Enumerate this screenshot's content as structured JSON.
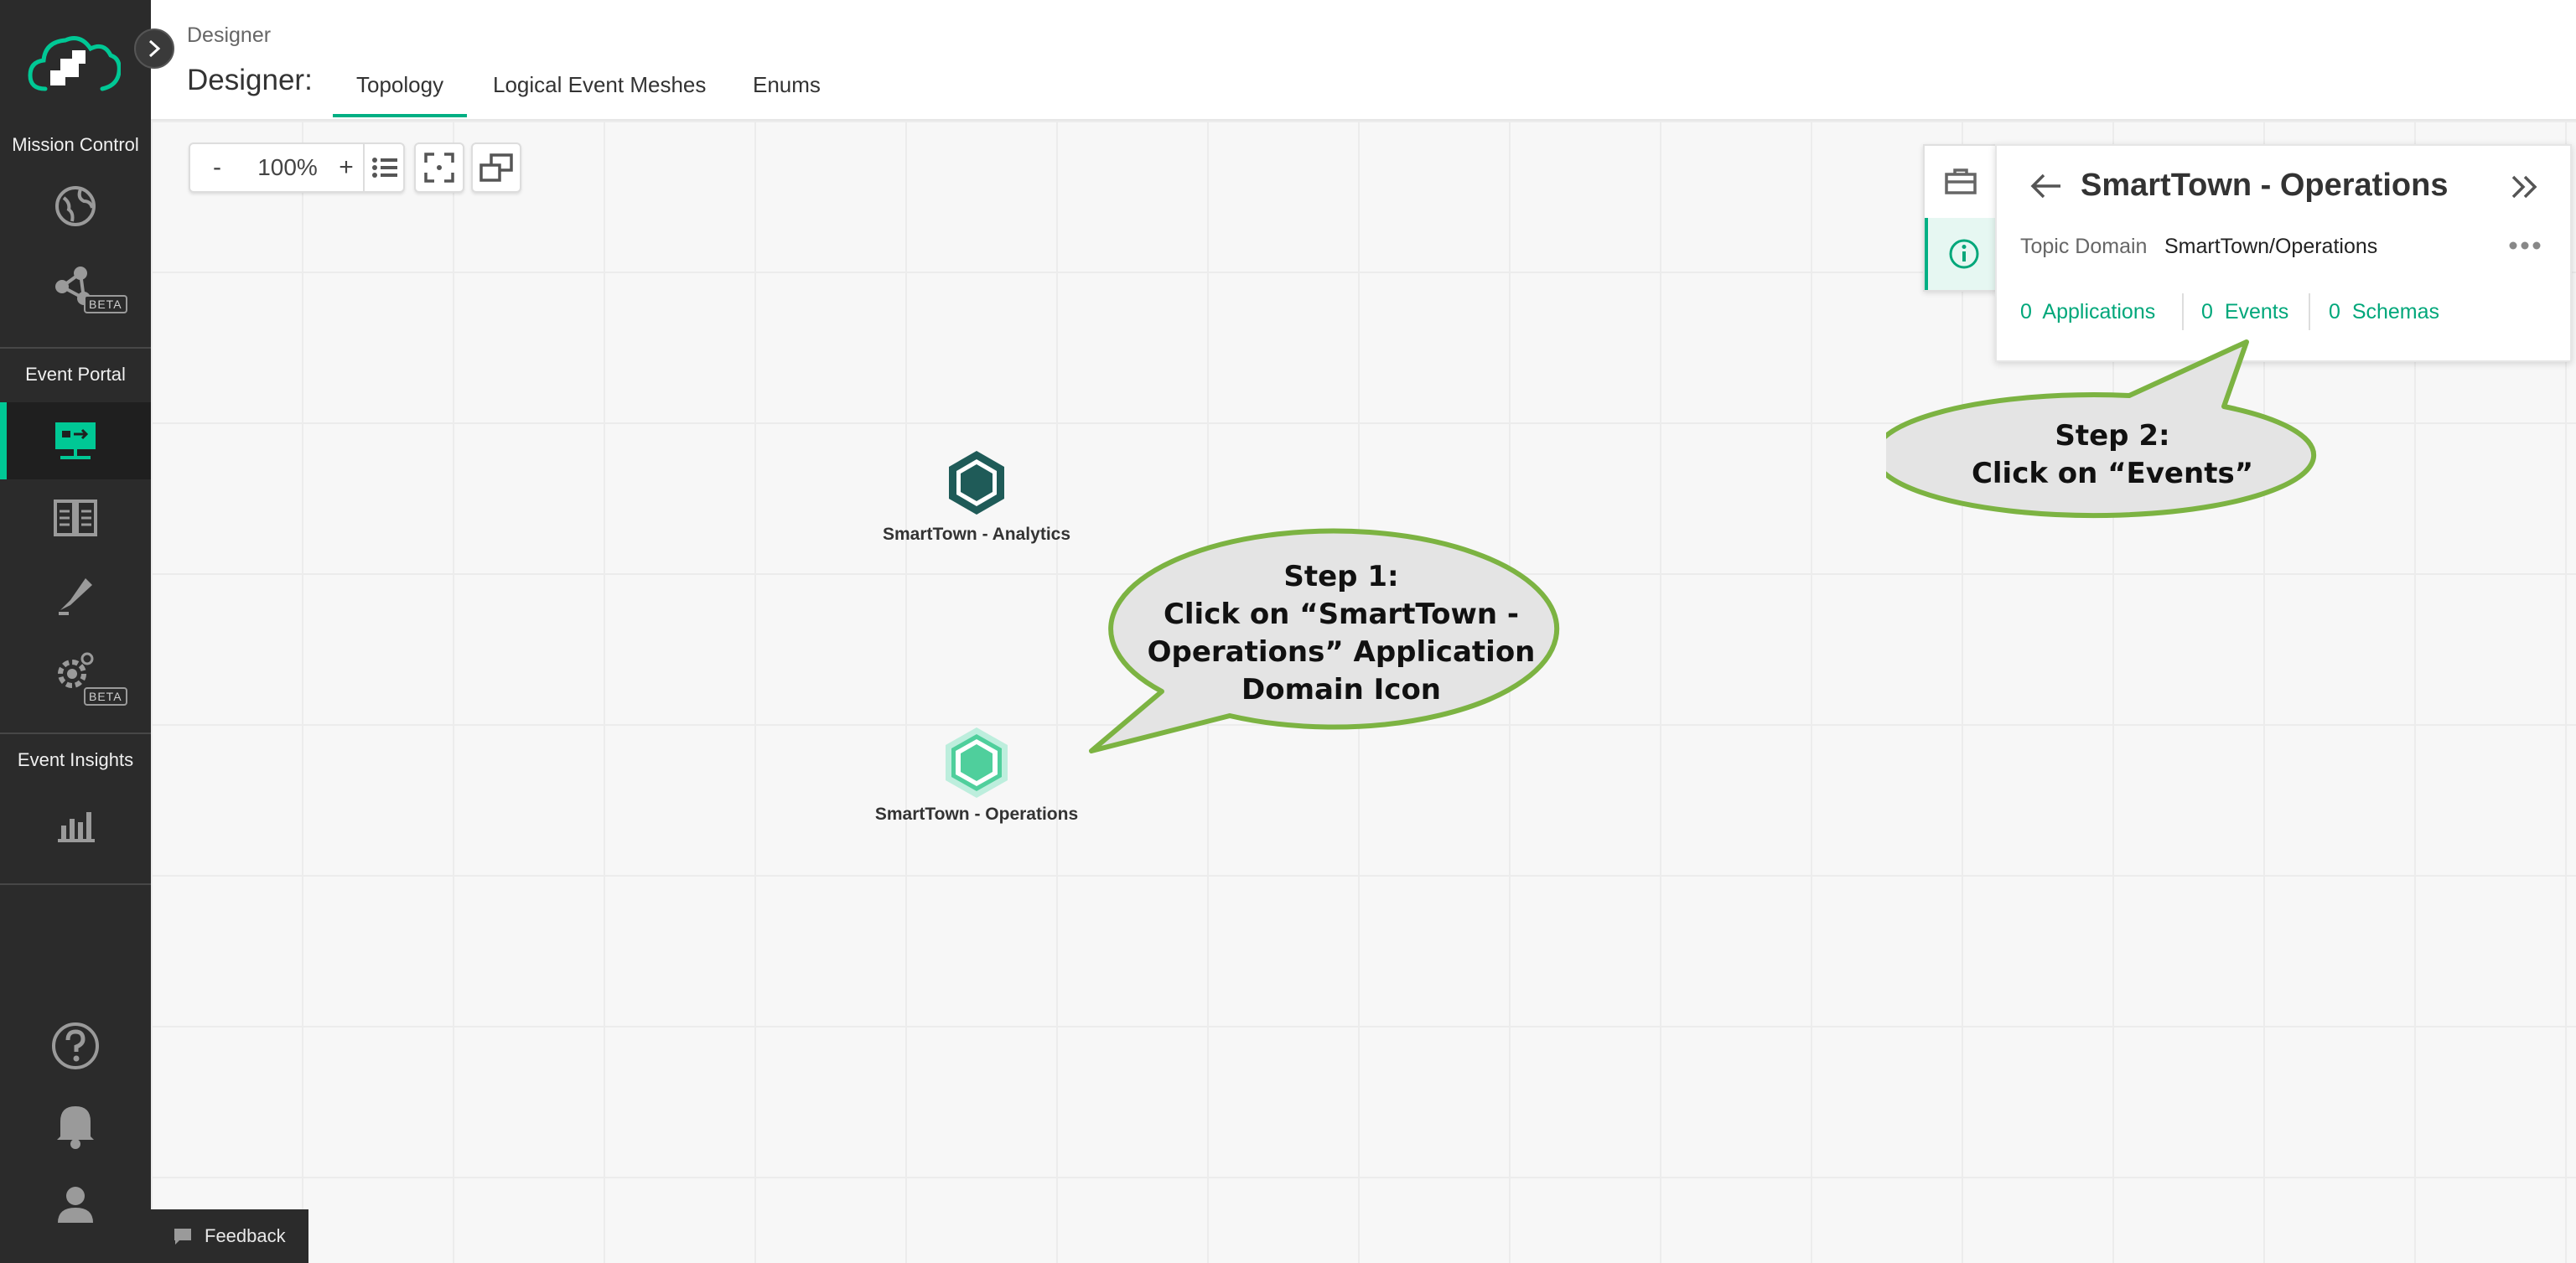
{
  "sidebar": {
    "sections": {
      "mission_control": "Mission Control",
      "event_portal": "Event Portal",
      "event_insights": "Event Insights"
    },
    "beta_label": "BETA",
    "icons": [
      "logo-icon",
      "globe-icon",
      "mesh-network-icon",
      "designer-icon",
      "catalog-icon",
      "event-api-icon",
      "runtime-settings-icon",
      "insights-chart-icon",
      "help-icon",
      "bell-icon",
      "user-icon"
    ],
    "accent_color": "#00c895"
  },
  "header": {
    "breadcrumb": "Designer",
    "title": "Designer:",
    "tabs": [
      {
        "label": "Topology",
        "active": true
      },
      {
        "label": "Logical Event Meshes",
        "active": false
      },
      {
        "label": "Enums",
        "active": false
      }
    ]
  },
  "toolbar": {
    "zoom_out": "-",
    "zoom_level": "100%",
    "zoom_in": "+"
  },
  "nodes": [
    {
      "label": "SmartTown - Analytics",
      "color": "#1f5b58"
    },
    {
      "label": "SmartTown - Operations",
      "color": "#4fcf9c"
    }
  ],
  "panel": {
    "title": "SmartTown - Operations",
    "field_label": "Topic Domain",
    "field_value": "SmartTown/Operations",
    "links": [
      {
        "count": "0",
        "label": "Applications"
      },
      {
        "count": "0",
        "label": "Events"
      },
      {
        "count": "0",
        "label": "Schemas"
      }
    ],
    "link_color": "#00a77a"
  },
  "callouts": {
    "step1": [
      "Step 1:",
      "Click on “SmartTown -",
      "Operations” Application",
      "Domain Icon"
    ],
    "step2": [
      "Step 2:",
      "Click on “Events”"
    ],
    "fill_color": "#e4e4e4",
    "stroke_color": "#7cb342"
  },
  "feedback": {
    "label": "Feedback"
  }
}
